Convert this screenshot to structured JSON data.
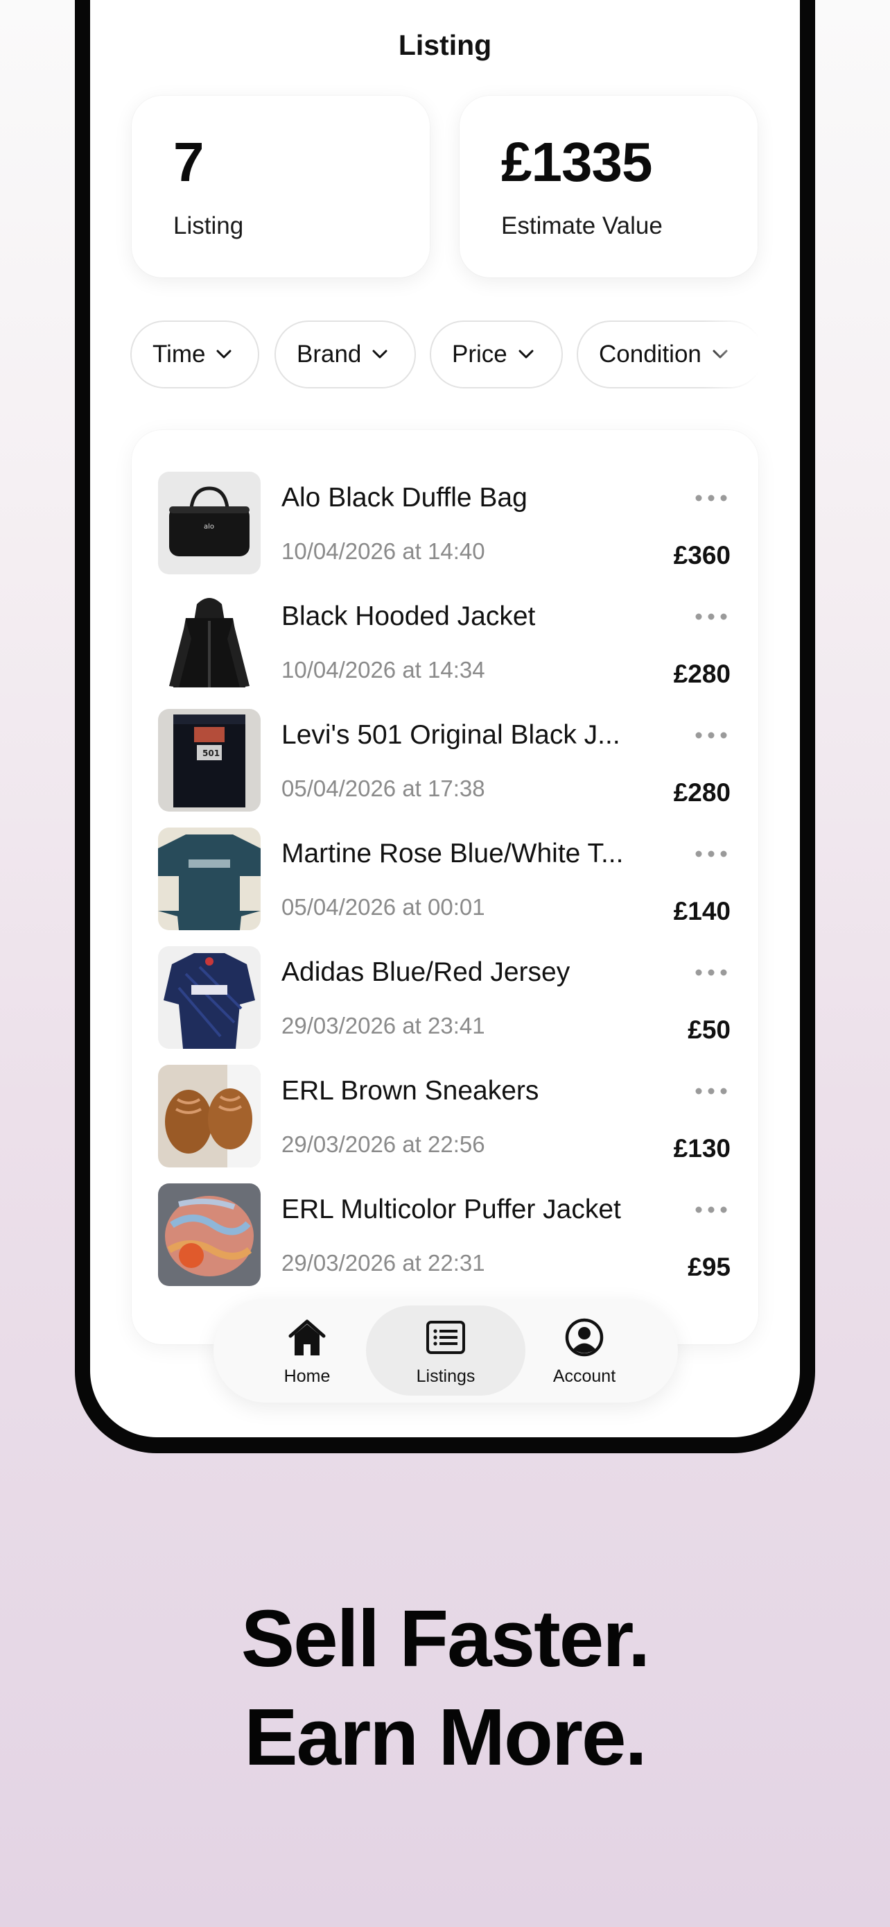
{
  "screen": {
    "title": "Listing"
  },
  "stats": {
    "listing_count": "7",
    "listing_label": "Listing",
    "estimate_value": "£1335",
    "estimate_label": "Estimate Value"
  },
  "filters": [
    {
      "label": "Time"
    },
    {
      "label": "Brand"
    },
    {
      "label": "Price"
    },
    {
      "label": "Condition"
    }
  ],
  "listings": [
    {
      "title": "Alo Black Duffle Bag",
      "date": "10/04/2026 at 14:40",
      "price": "£360",
      "thumb_icon": "duffle-bag-photo"
    },
    {
      "title": "Black Hooded Jacket",
      "date": "10/04/2026 at 14:34",
      "price": "£280",
      "thumb_icon": "hooded-jacket-photo"
    },
    {
      "title": "Levi's 501 Original Black J...",
      "date": "05/04/2026 at 17:38",
      "price": "£280",
      "thumb_icon": "jeans-photo"
    },
    {
      "title": "Martine Rose Blue/White T...",
      "date": "05/04/2026 at 00:01",
      "price": "£140",
      "thumb_icon": "tshirt-photo"
    },
    {
      "title": "Adidas Blue/Red Jersey",
      "date": "29/03/2026 at 23:41",
      "price": "£50",
      "thumb_icon": "jersey-photo"
    },
    {
      "title": "ERL Brown Sneakers",
      "date": "29/03/2026 at 22:56",
      "price": "£130",
      "thumb_icon": "sneakers-photo"
    },
    {
      "title": "ERL Multicolor Puffer Jacket",
      "date": "29/03/2026 at 22:31",
      "price": "£95",
      "thumb_icon": "puffer-jacket-photo"
    }
  ],
  "tabbar": {
    "home": "Home",
    "listings": "Listings",
    "account": "Account",
    "active": "listings"
  },
  "marketing": {
    "line1": "Sell Faster.",
    "line2": "Earn More."
  },
  "colors": {
    "text": "#111111",
    "muted": "#8a8a8a",
    "frame": "#070707",
    "background_top": "#fafafa",
    "background_bottom": "#e3d4e4"
  }
}
